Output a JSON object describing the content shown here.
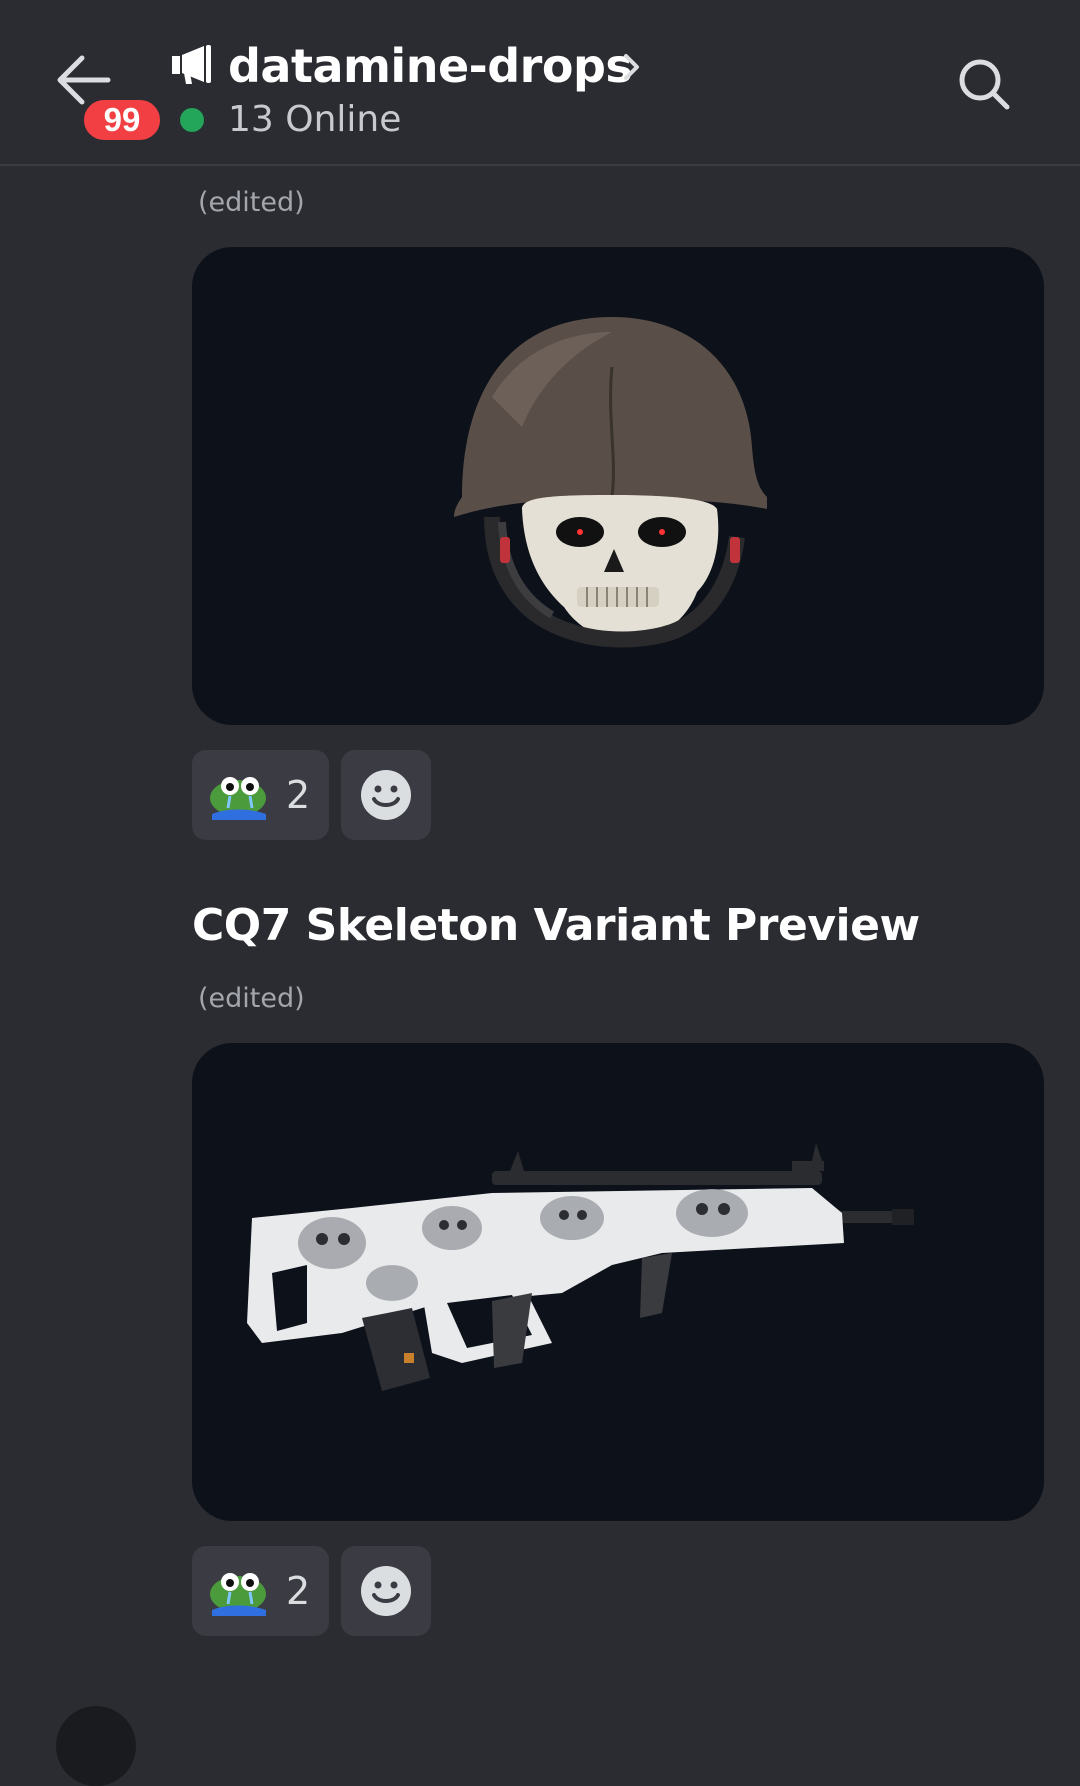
{
  "header": {
    "unread_count": "99",
    "channel_name": "datamine-drops",
    "online_text": "13 Online",
    "channel_icon": "megaphone-icon",
    "online_color": "#23a55a",
    "badge_color": "#f23f43"
  },
  "messages": [
    {
      "edited_label": "(edited)",
      "attachment": "skull-helmet-image",
      "reactions": [
        {
          "emoji": "crying-frog-emoji",
          "count": "2"
        }
      ],
      "add_reaction_icon": "smile-icon"
    },
    {
      "title": "CQ7 Skeleton Variant Preview",
      "edited_label": "(edited)",
      "attachment": "skeleton-rifle-image",
      "reactions": [
        {
          "emoji": "crying-frog-emoji",
          "count": "2"
        }
      ],
      "add_reaction_icon": "smile-icon"
    }
  ],
  "colors": {
    "background": "#2b2c31",
    "attachment_bg": "#0c111a",
    "reaction_bg": "#3b3c43"
  }
}
